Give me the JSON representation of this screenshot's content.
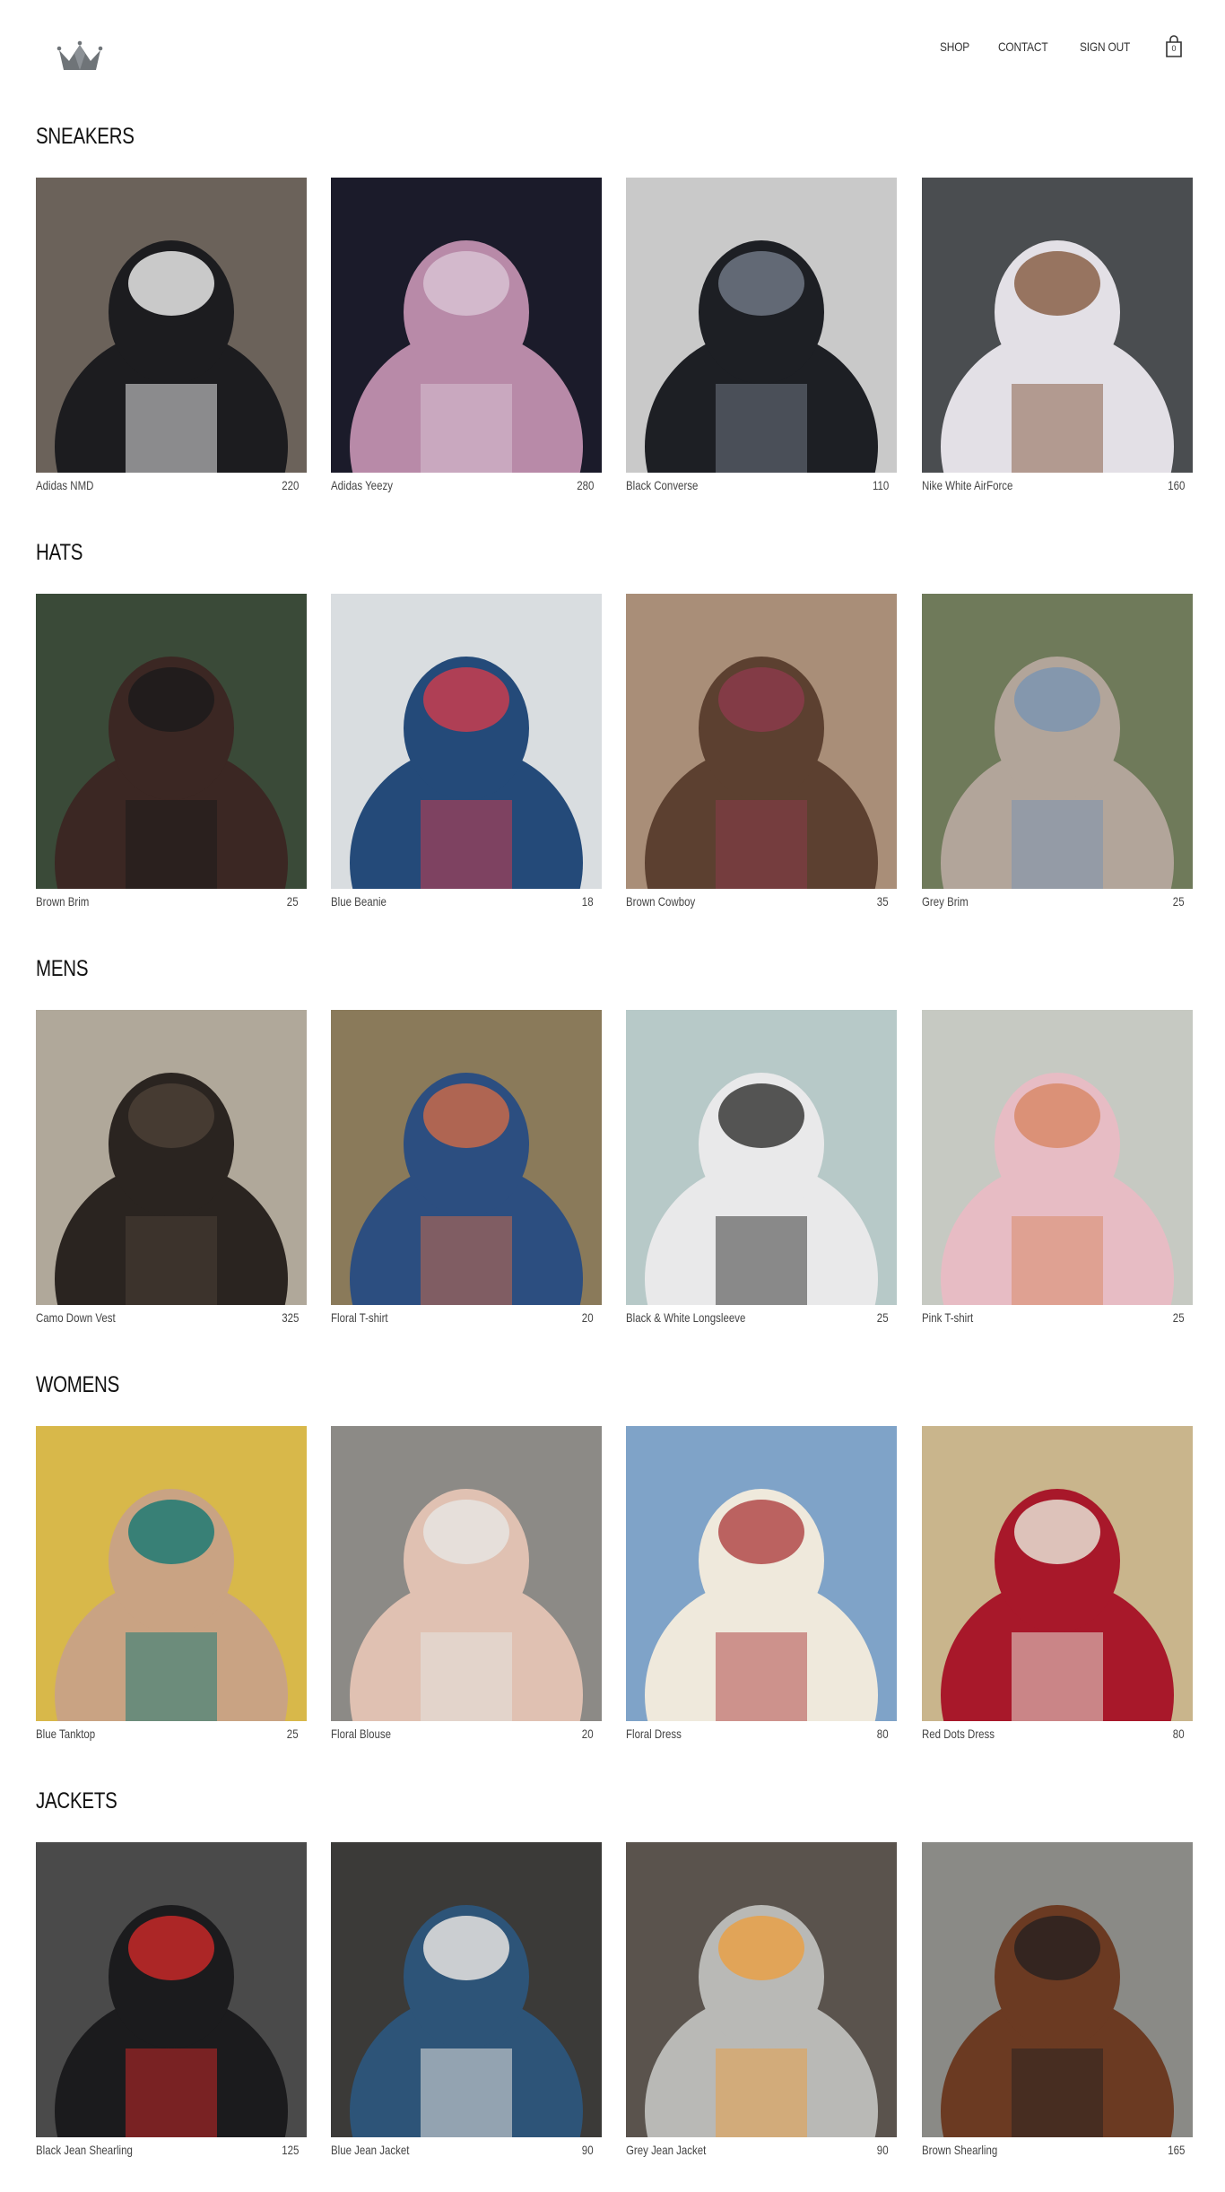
{
  "header": {
    "logo_icon": "crown-icon",
    "nav": [
      {
        "label": "SHOP"
      },
      {
        "label": "CONTACT"
      },
      {
        "label": "SIGN OUT"
      }
    ],
    "cart_icon": "shopping-bag-icon",
    "cart_count": "0"
  },
  "sections": [
    {
      "title": "SNEAKERS",
      "items": [
        {
          "name": "Adidas NMD",
          "price": "220",
          "colors": [
            "#6b625a",
            "#1c1c1f",
            "#e8e8e8"
          ]
        },
        {
          "name": "Adidas Yeezy",
          "price": "280",
          "colors": [
            "#1b1b2a",
            "#b88aa8",
            "#d7c1d2"
          ]
        },
        {
          "name": "Black Converse",
          "price": "110",
          "colors": [
            "#c9c9c9",
            "#1d1f24",
            "#6f7784"
          ]
        },
        {
          "name": "Nike White AirForce",
          "price": "160",
          "colors": [
            "#4a4d50",
            "#e3e0e6",
            "#8a6048"
          ]
        }
      ]
    },
    {
      "title": "HATS",
      "items": [
        {
          "name": "Brown Brim",
          "price": "25",
          "colors": [
            "#3a4a38",
            "#3b2723",
            "#1d1b1b"
          ]
        },
        {
          "name": "Blue Beanie",
          "price": "18",
          "colors": [
            "#d9dde0",
            "#244a79",
            "#c83d4f"
          ]
        },
        {
          "name": "Brown Cowboy",
          "price": "35",
          "colors": [
            "#a98e78",
            "#5c4030",
            "#8a3b4a"
          ]
        },
        {
          "name": "Grey Brim",
          "price": "25",
          "colors": [
            "#6f7a5a",
            "#b2a59a",
            "#7b94b0"
          ]
        }
      ]
    },
    {
      "title": "MENS",
      "items": [
        {
          "name": "Camo Down Vest",
          "price": "325",
          "colors": [
            "#b0a89a",
            "#2a2420",
            "#4b4036"
          ]
        },
        {
          "name": "Floral T-shirt",
          "price": "20",
          "colors": [
            "#8a7a5a",
            "#2c4e80",
            "#c76a4a"
          ]
        },
        {
          "name": "Black & White Longsleeve",
          "price": "25",
          "colors": [
            "#b7c9c8",
            "#e9e9ea",
            "#3a3a38"
          ]
        },
        {
          "name": "Pink T-shirt",
          "price": "25",
          "colors": [
            "#c6c9c2",
            "#e7bcc4",
            "#d88a6a"
          ]
        }
      ]
    },
    {
      "title": "WOMENS",
      "items": [
        {
          "name": "Blue Tanktop",
          "price": "25",
          "colors": [
            "#d8b84a",
            "#c9a383",
            "#1f7a74"
          ]
        },
        {
          "name": "Floral Blouse",
          "price": "20",
          "colors": [
            "#8c8a86",
            "#e0c1b2",
            "#e6e4e0"
          ]
        },
        {
          "name": "Floral Dress",
          "price": "80",
          "colors": [
            "#7fa3c8",
            "#efe9dc",
            "#b14a4a"
          ]
        },
        {
          "name": "Red Dots Dress",
          "price": "80",
          "colors": [
            "#c9b58c",
            "#a8182a",
            "#e6e0d4"
          ]
        }
      ]
    },
    {
      "title": "JACKETS",
      "items": [
        {
          "name": "Black Jean Shearling",
          "price": "125",
          "colors": [
            "#4a4a4a",
            "#1b1b1d",
            "#c62828"
          ]
        },
        {
          "name": "Blue Jean Jacket",
          "price": "90",
          "colors": [
            "#3b3a38",
            "#2d5478",
            "#e8e4e0"
          ]
        },
        {
          "name": "Grey Jean Jacket",
          "price": "90",
          "colors": [
            "#5a534d",
            "#b9b9b6",
            "#e7a048"
          ]
        },
        {
          "name": "Brown Shearling",
          "price": "165",
          "colors": [
            "#8a8a86",
            "#6b3a22",
            "#2a2220"
          ]
        }
      ]
    }
  ]
}
